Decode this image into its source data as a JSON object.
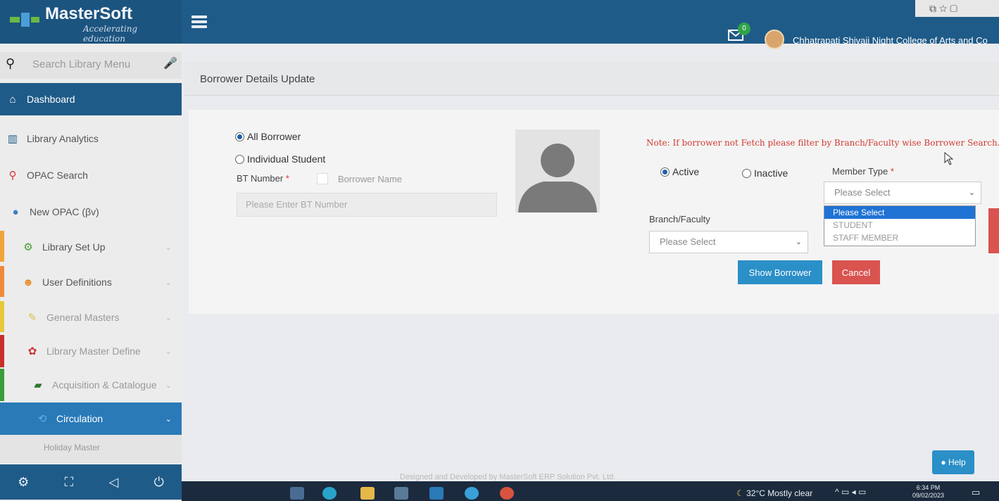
{
  "header": {
    "logo_title": "MasterSoft",
    "logo_subtitle": "Accelerating education",
    "mail_badge": "0",
    "college_name": "Chhatrapati Shivaji Night College of Arts and Co"
  },
  "sidebar": {
    "search_placeholder": "Search Library Menu",
    "items": [
      {
        "label": "Dashboard",
        "icon": "home-icon"
      },
      {
        "label": "Library Analytics",
        "icon": "bar-chart-icon"
      },
      {
        "label": "OPAC Search",
        "icon": "search-icon"
      },
      {
        "label": "New OPAC (βv)",
        "icon": "globe-icon"
      },
      {
        "label": "Library Set Up",
        "icon": "gears-icon"
      },
      {
        "label": "User Definitions",
        "icon": "users-icon"
      },
      {
        "label": "General Masters",
        "icon": "edit-icon"
      },
      {
        "label": "Library Master Define",
        "icon": "cubes-icon"
      },
      {
        "label": "Acquisition & Catalogue",
        "icon": "book-icon"
      },
      {
        "label": "Circulation",
        "icon": "refresh-icon"
      }
    ],
    "sub_item": "Holiday Master"
  },
  "main": {
    "page_title": "Borrower Details Update",
    "radio_all": "All Borrower",
    "radio_individual": "Individual Student",
    "bt_label": "BT Number",
    "required_mark": "*",
    "borrower_name_label": "Borrower Name",
    "bt_placeholder": "Please Enter BT Number",
    "note": "Note: If borrower not Fetch please filter by Branch/Faculty wise Borrower Search.",
    "status_active": "Active",
    "status_inactive": "Inactive",
    "member_type_label": "Member Type",
    "member_type_value": "Please Select",
    "member_type_options": [
      "Please Select",
      "STUDENT",
      "STAFF MEMBER"
    ],
    "branch_label": "Branch/Faculty",
    "branch_value": "Please Select",
    "show_button": "Show Borrower",
    "cancel_button": "Cancel",
    "footer": "Designed and Developed by MasterSoft ERP Solution Pvt. Ltd.",
    "help_button": "Help"
  },
  "taskbar": {
    "weather": "32°C  Mostly clear",
    "time": "6:34 PM",
    "date": "09/02/2023"
  },
  "colors": {
    "primary": "#1f5b88",
    "show_button": "#2b8fc8",
    "cancel_button": "#d9534f",
    "note": "#d23b32"
  }
}
